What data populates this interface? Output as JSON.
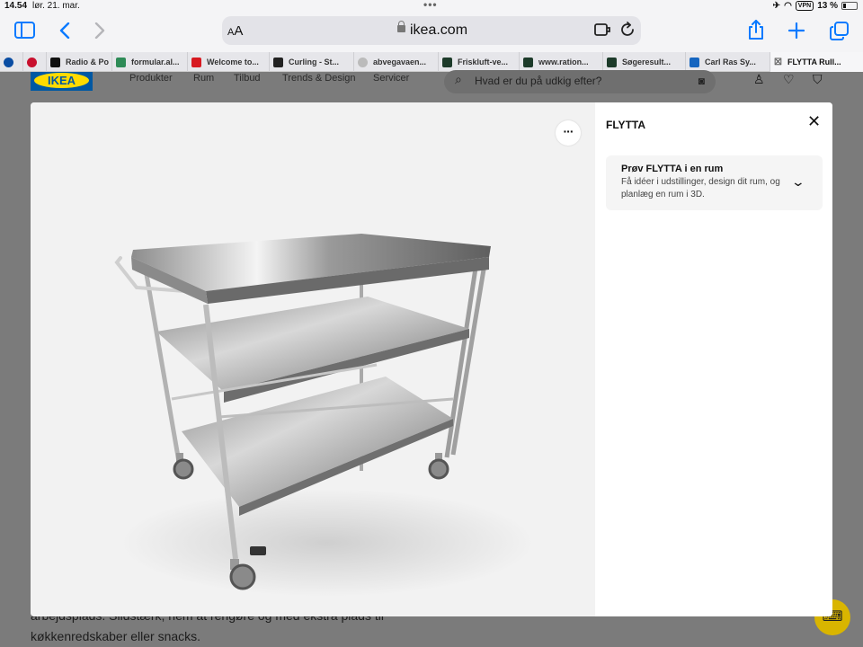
{
  "status_bar": {
    "time": "14.54",
    "date": "lør. 21. mar.",
    "vpn": "VPN",
    "battery": "13 %"
  },
  "browser": {
    "url_aa_small": "A",
    "url_aa_large": "A",
    "domain": "ikea.com",
    "tabs": [
      {
        "title": "",
        "color": "#0a4da3"
      },
      {
        "title": "",
        "color": "#c8102e"
      },
      {
        "title": "Radio & Po",
        "color": "#111111"
      },
      {
        "title": "formular.al...",
        "color": "#2e8b57"
      },
      {
        "title": "Welcome to...",
        "color": "#d71920"
      },
      {
        "title": "Curling - St...",
        "color": "#222222"
      },
      {
        "title": "abvegavaen...",
        "color": "#bbbbbb"
      },
      {
        "title": "Friskluft-ve...",
        "color": "#1d3b2a"
      },
      {
        "title": "www.ration...",
        "color": "#1d3b2a"
      },
      {
        "title": "Søgeresult...",
        "color": "#1d3b2a"
      },
      {
        "title": "Carl Ras Sy...",
        "color": "#1565c0"
      },
      {
        "title": "FLYTTA Rull...",
        "color": "#888888"
      }
    ]
  },
  "background_page": {
    "logo": "IKEA",
    "nav": [
      "Produkter",
      "Rum",
      "Tilbud",
      "Trends & Design",
      "Servicer"
    ],
    "search_placeholder": "Hvad er du på udkig efter?",
    "body_line1": "arbejdsplads. Slidstærk, nem at rengøre og med ekstra plads til",
    "body_line2": "køkkenredskaber eller snacks."
  },
  "modal": {
    "more_label": "···",
    "title": "FLYTTA",
    "close_label": "✕",
    "card": {
      "title": "Prøv FLYTTA i en rum",
      "description": "Få idéer i udstillinger, design dit rum, og planlæg en rum i 3D."
    }
  }
}
